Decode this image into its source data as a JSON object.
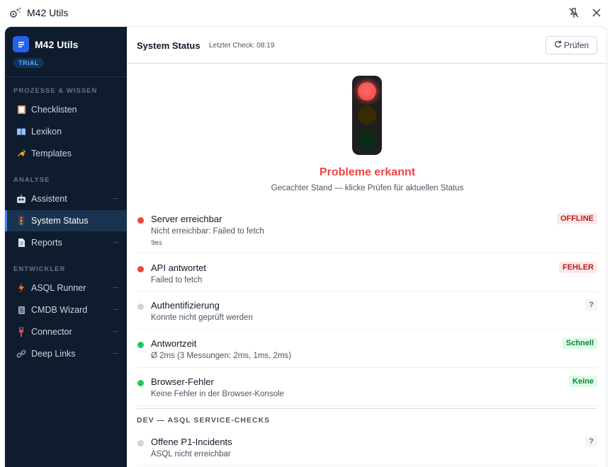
{
  "window": {
    "title": "M42 Utils"
  },
  "sidebar": {
    "brand_name": "M42 Utils",
    "trial_label": "TRIAL",
    "sections": [
      {
        "label": "PROZESSE & WISSEN",
        "items": [
          {
            "label": "Checklisten",
            "icon": "clipboard-icon"
          },
          {
            "label": "Lexikon",
            "icon": "book-icon"
          },
          {
            "label": "Templates",
            "icon": "writing-hand-icon"
          }
        ]
      },
      {
        "label": "ANALYSE",
        "items": [
          {
            "label": "Assistent",
            "icon": "robot-icon"
          },
          {
            "label": "System Status",
            "icon": "traffic-light-icon",
            "active": true
          },
          {
            "label": "Reports",
            "icon": "document-icon"
          }
        ]
      },
      {
        "label": "ENTWICKLER",
        "items": [
          {
            "label": "ASQL Runner",
            "icon": "lightning-icon"
          },
          {
            "label": "CMDB Wizard",
            "icon": "database-icon"
          },
          {
            "label": "Connector",
            "icon": "plug-icon"
          },
          {
            "label": "Deep Links",
            "icon": "link-icon"
          }
        ]
      }
    ]
  },
  "header": {
    "title": "System Status",
    "last_check": "Letzter Check: 08:19",
    "check_button_label": "Prüfen"
  },
  "status": {
    "headline": "Probleme erkannt",
    "subtitle": "Gecachter Stand — klicke Prüfen für aktuellen Status",
    "light": "red"
  },
  "checks": [
    {
      "title": "Server erreichbar",
      "desc": "Nicht erreichbar: Failed to fetch",
      "extra": "9ms",
      "badge": "OFFLINE",
      "status": "error"
    },
    {
      "title": "API antwortet",
      "desc": "Failed to fetch",
      "badge": "FEHLER",
      "status": "error"
    },
    {
      "title": "Authentifizierung",
      "desc": "Konnte nicht geprüft werden",
      "badge": "?",
      "status": "unknown"
    },
    {
      "title": "Antwortzeit",
      "desc": "Ø 2ms (3 Messungen: 2ms, 1ms, 2ms)",
      "badge": "Schnell",
      "status": "ok"
    },
    {
      "title": "Browser-Fehler",
      "desc": "Keine Fehler in der Browser-Konsole",
      "badge": "Keine",
      "status": "ok"
    }
  ],
  "dev_section": {
    "label": "DEV — ASQL SERVICE-CHECKS",
    "checks": [
      {
        "title": "Offene P1-Incidents",
        "desc": "ASQL nicht erreichbar",
        "badge": "?",
        "status": "unknown"
      }
    ]
  },
  "colors": {
    "sidebar_bg": "#0f1c2e",
    "accent": "#3b82f6",
    "error": "#ef4444",
    "ok": "#22c55e",
    "unknown": "#cbd5e1"
  }
}
